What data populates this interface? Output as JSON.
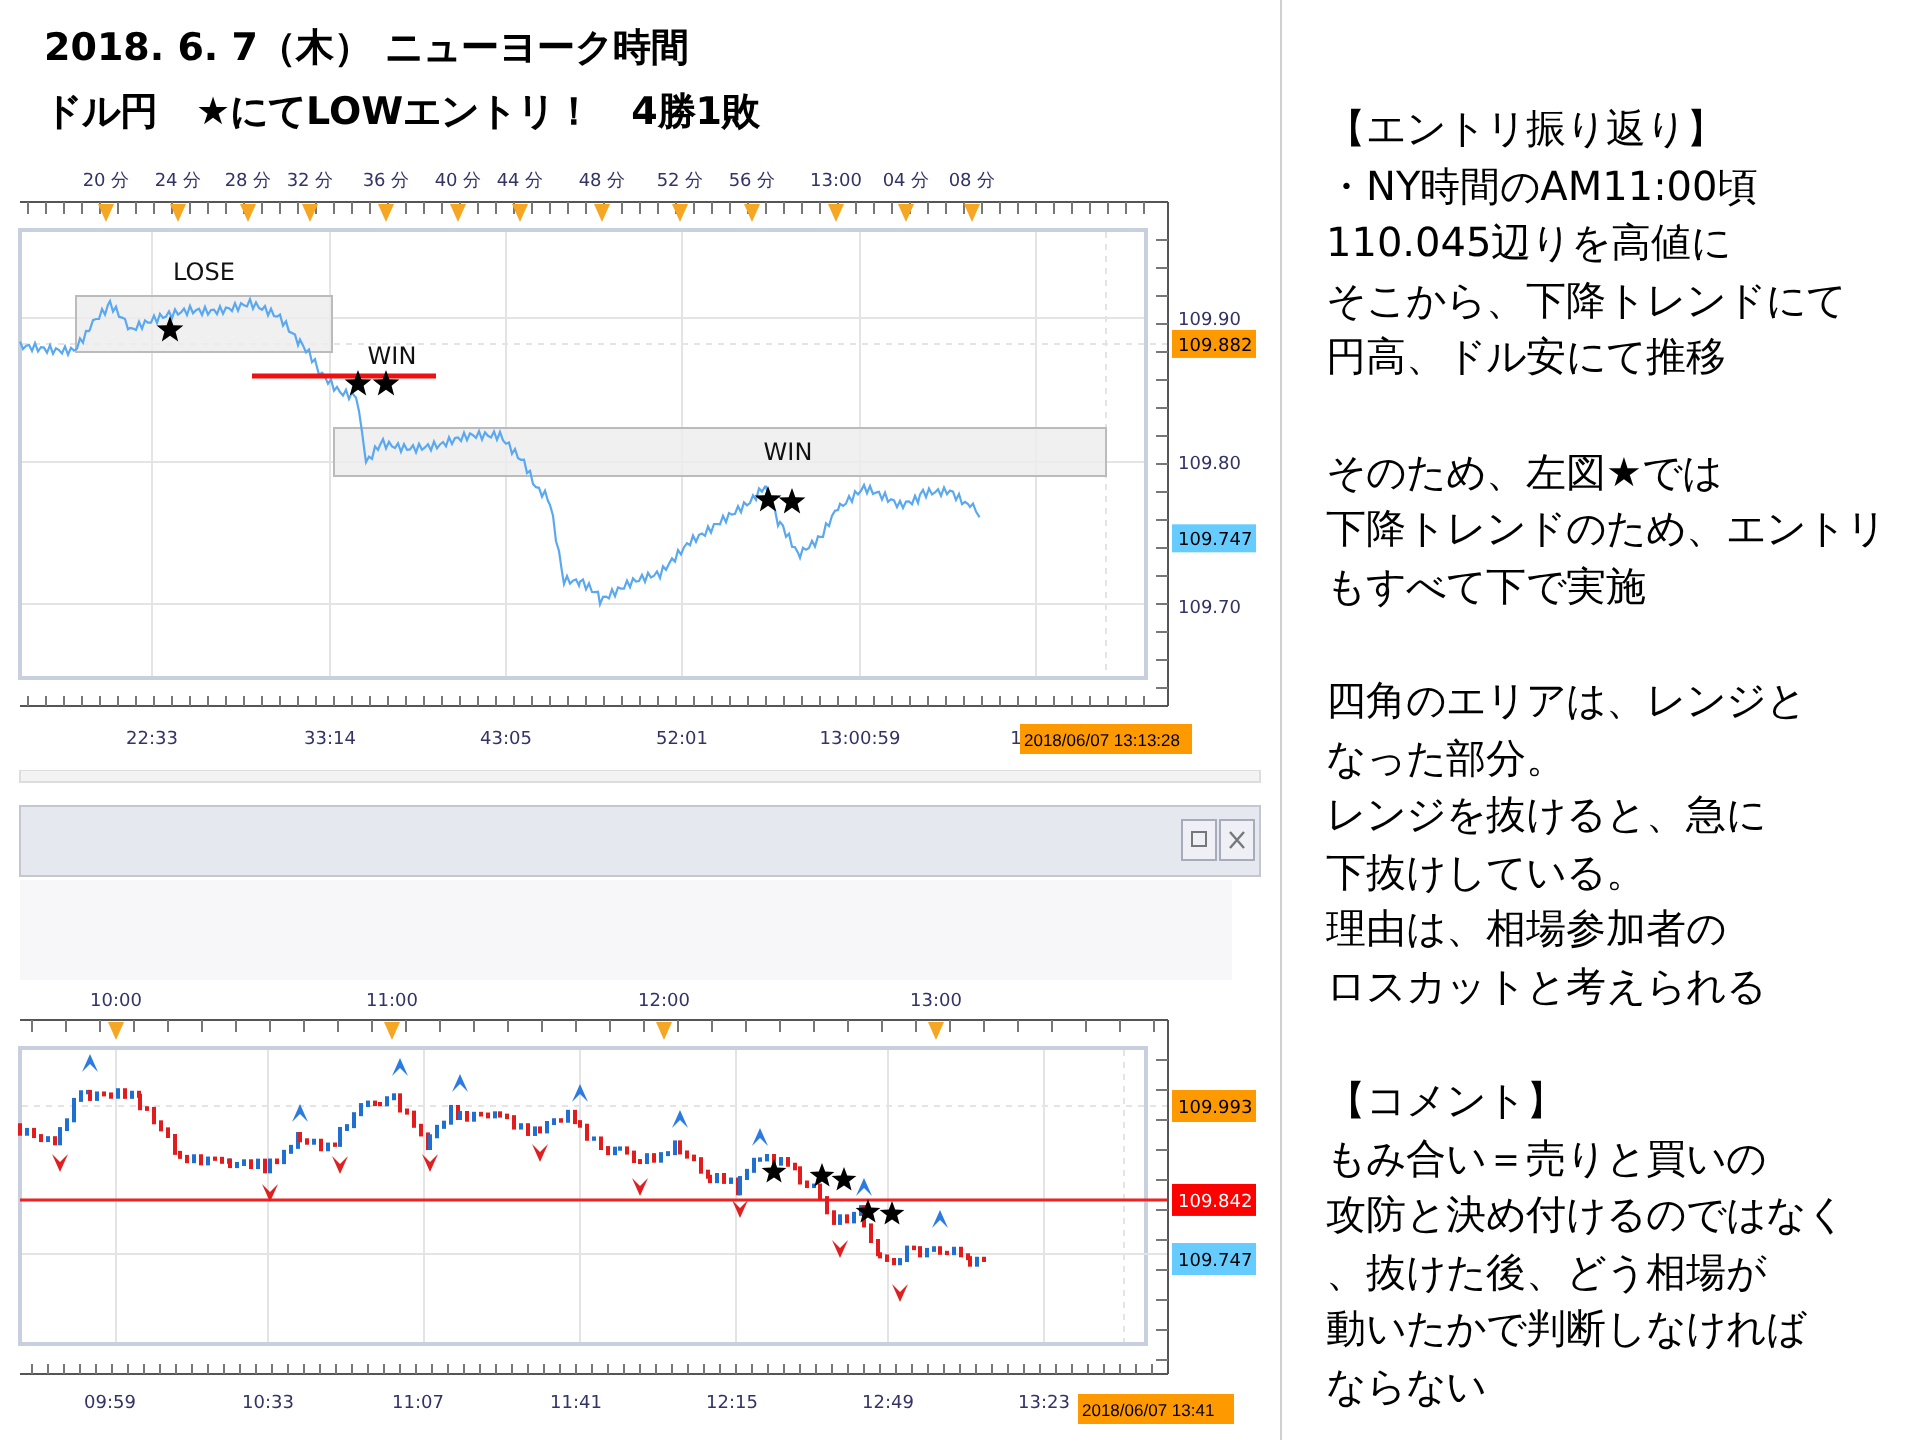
{
  "title": {
    "lines": [
      "2018. 6. 7（木） ニューヨーク時間",
      "ドル円　★にてLOWエントリ！　4勝1敗"
    ]
  },
  "chart_top": {
    "top_labels": [
      "20 分",
      "24 分",
      "28 分",
      "32 分",
      "36 分",
      "40 分",
      "44 分",
      "48 分",
      "52 分",
      "56 分",
      "13:00",
      "04 分",
      "08 分"
    ],
    "price_labels": [
      {
        "text": "109.90",
        "kind": "tick"
      },
      {
        "text": "109.882",
        "kind": "tag",
        "color": "#ff9900"
      },
      {
        "text": "109.80",
        "kind": "tick"
      },
      {
        "text": "109.747",
        "kind": "tag",
        "color": "#66ccff"
      },
      {
        "text": "109.70",
        "kind": "tick"
      }
    ],
    "time_labels": [
      "22:33",
      "33:14",
      "43:05",
      "52:01",
      "13:00:59",
      "1"
    ],
    "date_label": "2018/06/07 13:13:28",
    "annotations": [
      {
        "text": "LOSE"
      },
      {
        "text": "WIN"
      },
      {
        "text": "WIN"
      }
    ]
  },
  "chart_bottom": {
    "top_labels": [
      "10:00",
      "11:00",
      "12:00",
      "13:00"
    ],
    "price_labels": [
      {
        "text": "109.993",
        "kind": "tag",
        "color": "#ff9900"
      },
      {
        "text": "109.842",
        "kind": "tag",
        "color": "#ff0000"
      },
      {
        "text": "109.747",
        "kind": "tag",
        "color": "#66ccff"
      }
    ],
    "time_labels": [
      "09:59",
      "10:33",
      "11:07",
      "11:41",
      "12:15",
      "12:49",
      "13:23"
    ],
    "date_label": "2018/06/07 13:41"
  },
  "notes": [
    {
      "kind": "heading",
      "text": "【エントリ振り返り】"
    },
    {
      "kind": "body",
      "lines": [
        "・NY時間のAM11:00頃",
        "110.045辺りを高値に",
        "そこから、下降トレンドにて",
        "円高、ドル安にて推移"
      ]
    },
    {
      "kind": "body",
      "lines": [
        "そのため、左図★では",
        "下降トレンドのため、エントリ",
        "もすべて下で実施"
      ]
    },
    {
      "kind": "body",
      "lines": [
        "四角のエリアは、レンジと",
        "なった部分。",
        "レンジを抜けると、急に",
        "下抜けしている。",
        "理由は、相場参加者の",
        "ロスカットと考えられる"
      ]
    },
    {
      "kind": "heading",
      "text": "【コメント】"
    },
    {
      "kind": "body",
      "lines": [
        "もみ合い＝売りと買いの",
        "攻防と決め付けるのではなく",
        "、抜けた後、どう相場が",
        "動いたかで判断しなければ",
        "ならない"
      ]
    }
  ]
}
